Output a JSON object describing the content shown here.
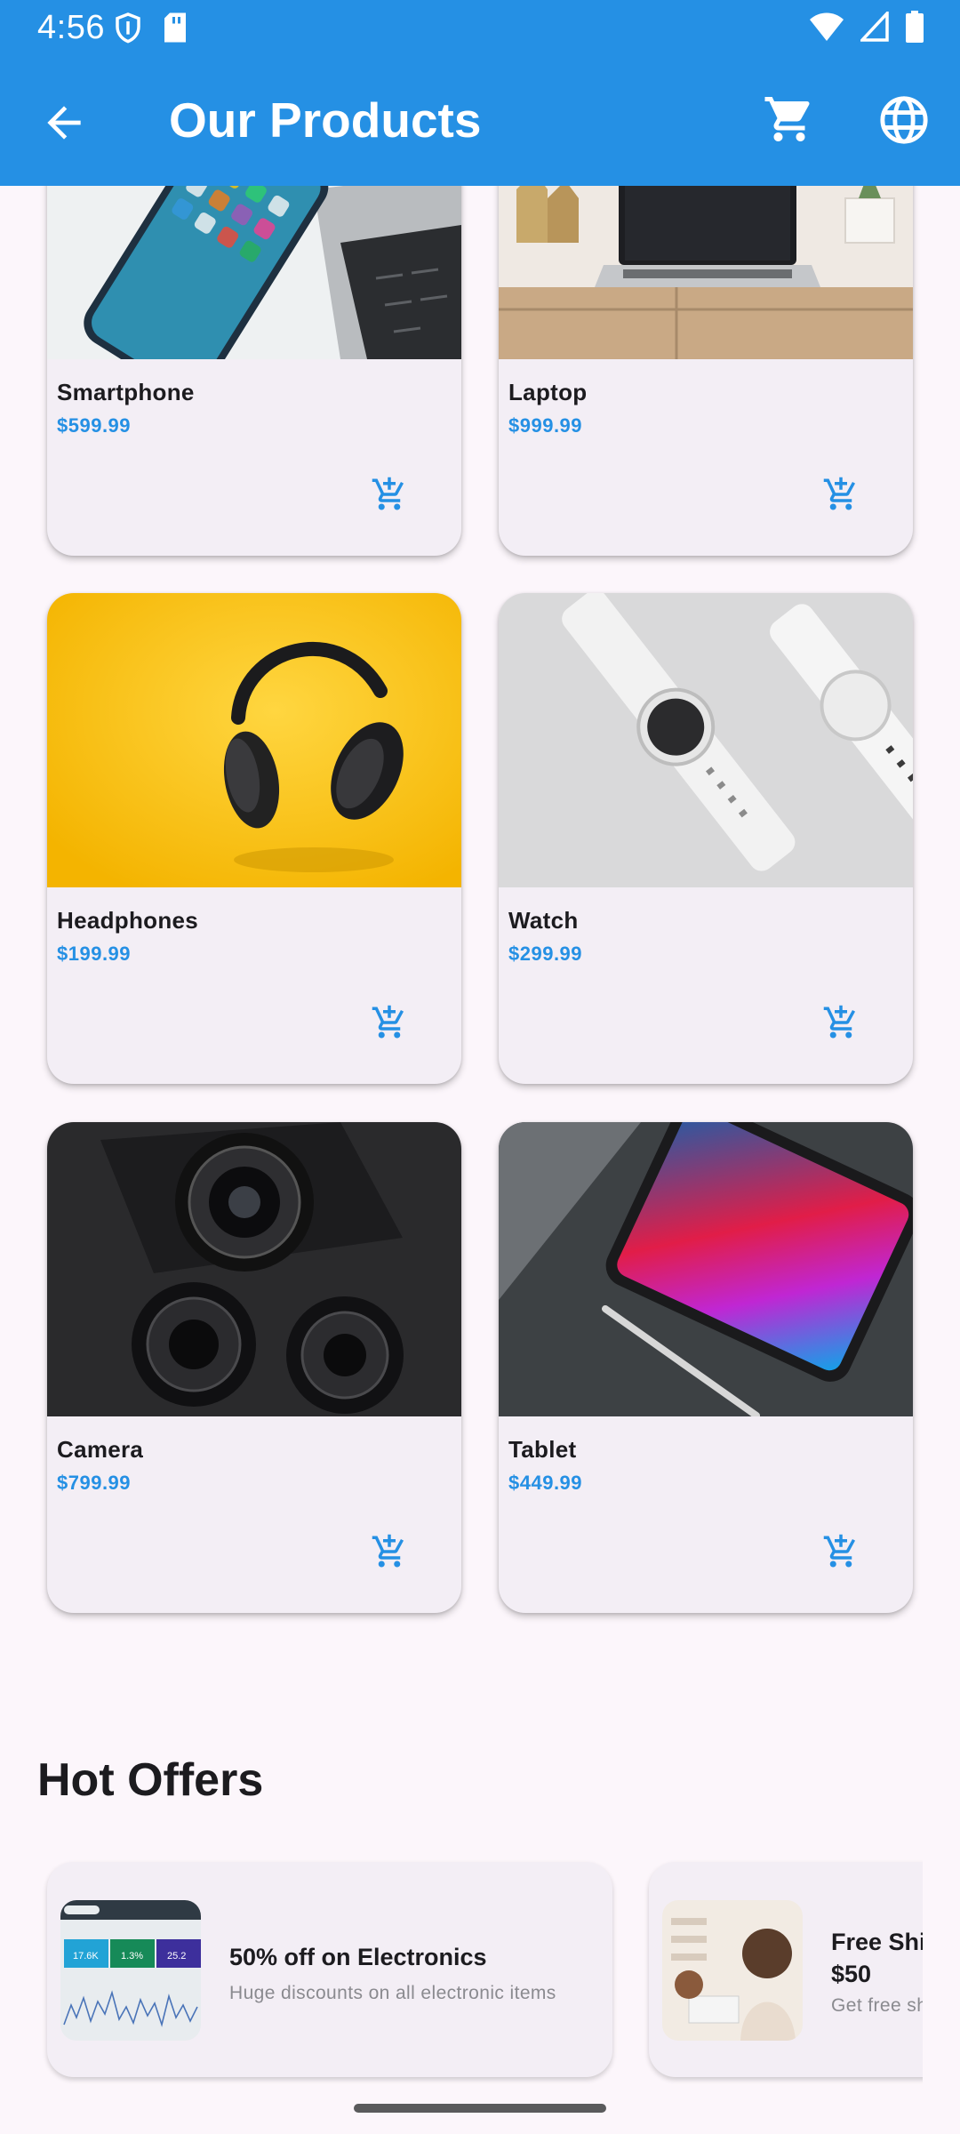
{
  "status": {
    "time": "4:56"
  },
  "appbar": {
    "title": "Our Products"
  },
  "products": [
    {
      "name": "Smartphone",
      "price": "$599.99"
    },
    {
      "name": "Laptop",
      "price": "$999.99"
    },
    {
      "name": "Headphones",
      "price": "$199.99"
    },
    {
      "name": "Watch",
      "price": "$299.99"
    },
    {
      "name": "Camera",
      "price": "$799.99"
    },
    {
      "name": "Tablet",
      "price": "$449.99"
    }
  ],
  "hot_offers": {
    "title": "Hot Offers",
    "items": [
      {
        "title": "50% off on Electronics",
        "subtitle": "Huge discounts on all electronic items",
        "chart_values": [
          "17.6K",
          "1.3%",
          "25.2"
        ]
      },
      {
        "title": "Free Shi",
        "title_line2": "$50",
        "subtitle": "Get free sh"
      }
    ]
  },
  "colors": {
    "primary": "#2590e4",
    "background": "#fcf6fb",
    "card": "#f3eef5"
  }
}
